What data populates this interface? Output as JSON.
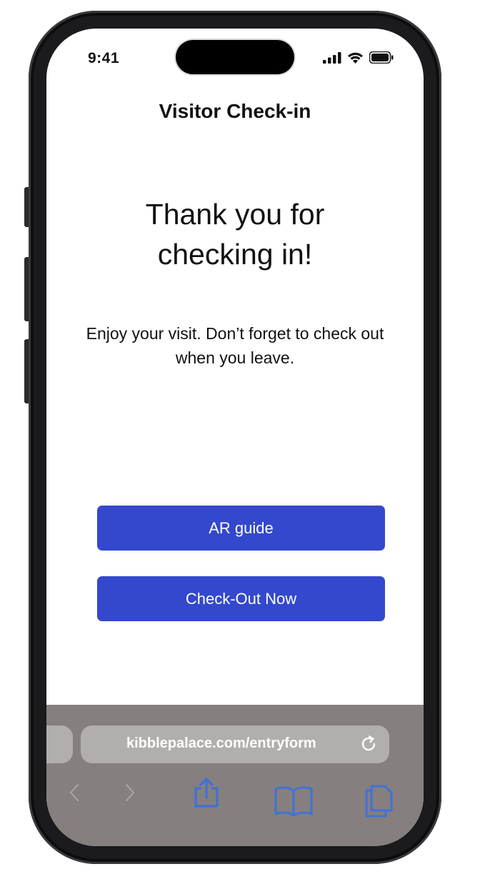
{
  "status_bar": {
    "time": "9:41"
  },
  "header": {
    "title": "Visitor Check-in"
  },
  "main": {
    "headline": "Thank you for checking in!",
    "message": "Enjoy your visit. Don’t forget to check out when you leave."
  },
  "actions": {
    "ar_guide_label": "AR guide",
    "checkout_label": "Check-Out Now"
  },
  "browser": {
    "url": "kibblepalace.com/entryform",
    "icons": [
      "back-icon",
      "forward-icon",
      "share-icon",
      "bookmarks-icon",
      "tabs-icon",
      "reload-icon"
    ]
  },
  "colors": {
    "primary_button": "#3348cc",
    "browser_bar": "#857f7f",
    "browser_pill": "#b3aeae",
    "toolbar_icon": "#3f72d6"
  }
}
